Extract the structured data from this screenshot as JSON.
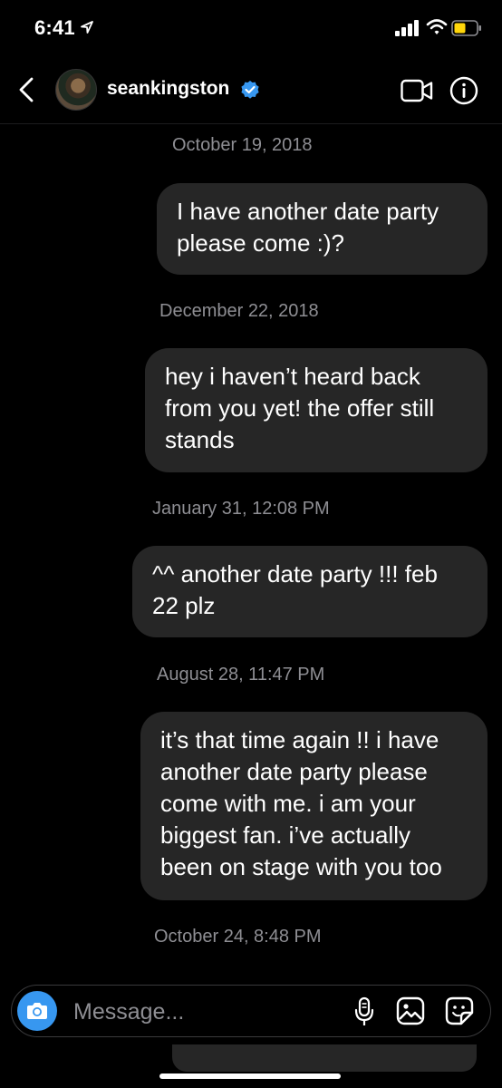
{
  "status_bar": {
    "time": "6:41"
  },
  "header": {
    "username": "seankingston"
  },
  "messages": [
    {
      "date": "October 19, 2018",
      "text": "I have another date party\nplease come :)?"
    },
    {
      "date": "December 22, 2018",
      "text": "hey i haven’t heard back\nfrom you yet! the offer still\nstands"
    },
    {
      "date": "January 31, 12:08 PM",
      "text": "^^ another date party !!! feb\n22 plz"
    },
    {
      "date": "August 28, 11:47 PM",
      "text": "it’s that time again !! i have\nanother date party please\ncome with me. i am your\nbiggest fan. i’ve actually\nbeen on stage with you too"
    },
    {
      "date": "October 24, 8:48 PM"
    }
  ],
  "composer": {
    "placeholder": "Message..."
  },
  "colors": {
    "accent": "#3797f0",
    "bubble": "#262626",
    "battery": "#ffd60a"
  }
}
